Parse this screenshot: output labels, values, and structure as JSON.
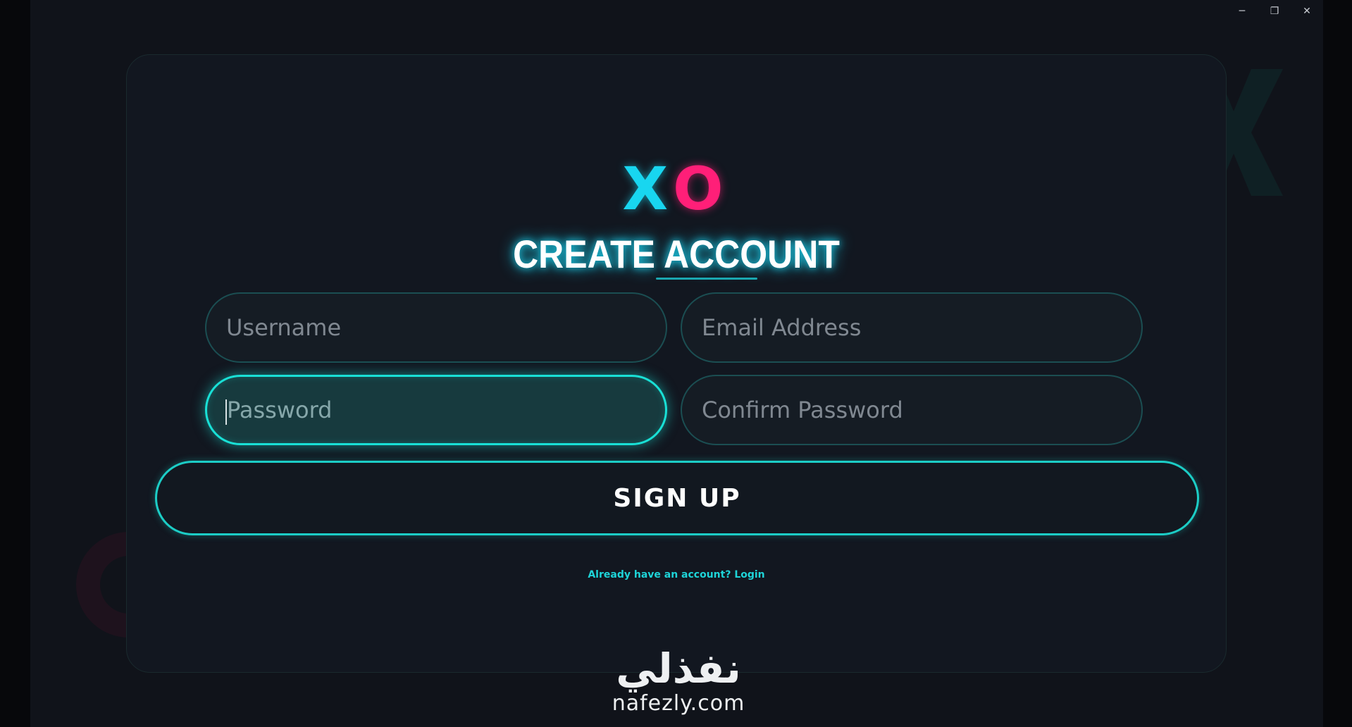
{
  "window": {
    "minimize_glyph": "─",
    "maximize_glyph": "❐",
    "close_glyph": "✕"
  },
  "logo": {
    "x": "X",
    "o": "O"
  },
  "title": "CREATE ACCOUNT",
  "fields": {
    "username": {
      "placeholder": "Username",
      "value": ""
    },
    "email": {
      "placeholder": "Email Address",
      "value": ""
    },
    "password": {
      "placeholder": "Password",
      "value": ""
    },
    "confirm_password": {
      "placeholder": "Confirm Password",
      "value": ""
    }
  },
  "signup_button": "SIGN UP",
  "login_link": "Already have an account? Login",
  "watermark": {
    "arabic": "نفذلي",
    "latin": "nafezly.com"
  },
  "colors": {
    "accent_cyan": "#19e0d6",
    "logo_x": "#18d6f0",
    "logo_o": "#ff1f78",
    "background": "#10131a"
  },
  "icons": [
    "minimize-icon",
    "restore-icon",
    "close-icon"
  ]
}
